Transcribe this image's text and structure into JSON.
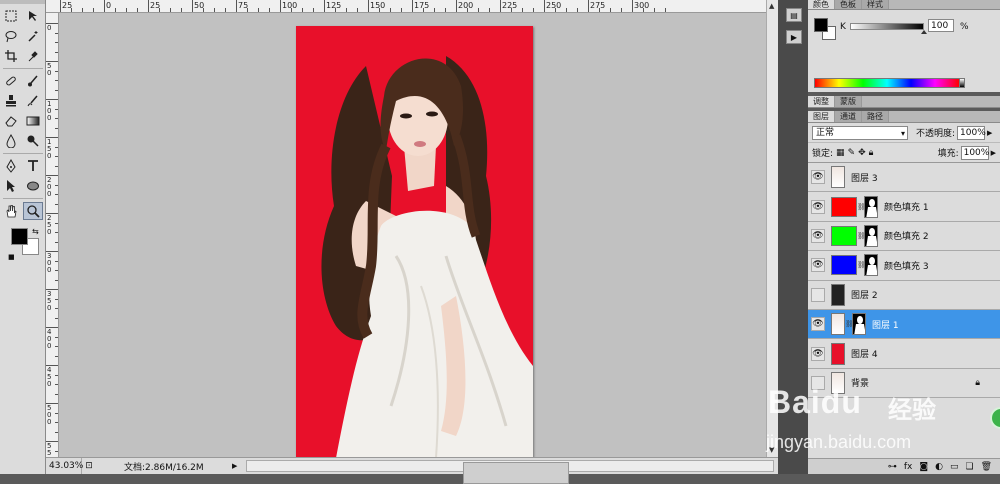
{
  "ruler": {
    "top_numbers": [
      "25",
      "0",
      "25",
      "50",
      "75",
      "100",
      "125",
      "150",
      "175",
      "200",
      "225",
      "250",
      "275",
      "300"
    ],
    "left_numbers": [
      "0",
      "50",
      "100",
      "150",
      "200",
      "250",
      "300",
      "350",
      "400",
      "450",
      "500",
      "550"
    ]
  },
  "status": {
    "zoom": "43.03%",
    "doc_info": "文档:2.86M/16.2M"
  },
  "color_panel": {
    "tabs": [
      "颜色",
      "色板",
      "样式"
    ],
    "k_label": "K",
    "k_value": "100",
    "k_percent": "%"
  },
  "adjust_panel": {
    "tabs": [
      "调整",
      "蒙版"
    ]
  },
  "layers_panel": {
    "tabs": [
      "图层",
      "通道",
      "路径"
    ],
    "blend_mode": "正常",
    "opacity_label": "不透明度:",
    "opacity_value": "100%",
    "lock_label": "锁定:",
    "fill_label": "填充:",
    "fill_value": "100%",
    "layers": [
      {
        "name": "图层 3",
        "visible": true,
        "kind": "photo",
        "selected": false
      },
      {
        "name": "颜色填充 1",
        "visible": true,
        "kind": "fill",
        "fill_color": "#ff0000",
        "selected": false
      },
      {
        "name": "颜色填充 2",
        "visible": true,
        "kind": "fill",
        "fill_color": "#00ff00",
        "selected": false
      },
      {
        "name": "颜色填充 3",
        "visible": true,
        "kind": "fill",
        "fill_color": "#0000ff",
        "selected": false
      },
      {
        "name": "图层 2",
        "visible": false,
        "kind": "dark",
        "selected": false
      },
      {
        "name": "图层 1",
        "visible": true,
        "kind": "photo-mask",
        "selected": true
      },
      {
        "name": "图层 4",
        "visible": true,
        "kind": "solid",
        "fill_color": "#e8102a",
        "selected": false
      },
      {
        "name": "背景",
        "visible": false,
        "kind": "background",
        "selected": false
      }
    ]
  },
  "colors": {
    "accent_selected": "#3e95e8",
    "canvas_bg": "#e8102a"
  },
  "watermark": {
    "logo": "Baidu",
    "cn": "经验",
    "url": "jingyan.baidu.com"
  }
}
